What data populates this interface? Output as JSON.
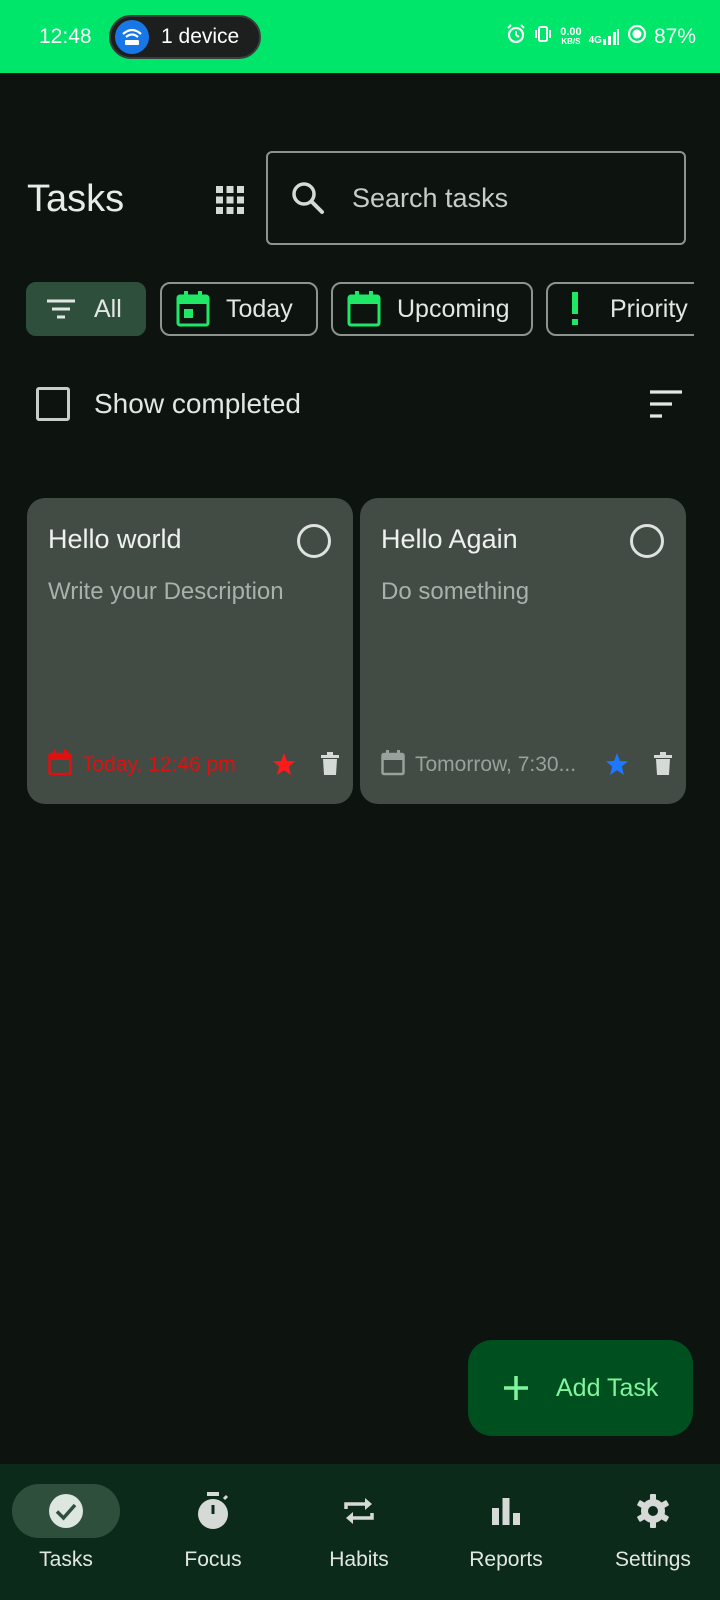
{
  "status_bar": {
    "time": "12:48",
    "hotspot_label": "1 device",
    "net_speed_value": "0.00",
    "net_speed_unit": "KB/S",
    "network": "4G",
    "battery": "87%"
  },
  "header": {
    "title": "Tasks",
    "search_placeholder": "Search tasks"
  },
  "filters": [
    {
      "label": "All",
      "icon": "filter-list-icon",
      "active": true
    },
    {
      "label": "Today",
      "icon": "calendar-today-icon",
      "active": false
    },
    {
      "label": "Upcoming",
      "icon": "calendar-icon",
      "active": false
    },
    {
      "label": "Priority",
      "icon": "priority-exclamation-icon",
      "active": false
    }
  ],
  "show_completed": {
    "label": "Show completed",
    "checked": false
  },
  "tasks": [
    {
      "title": "Hello world",
      "description": "Write your Description",
      "due": "Today, 12:46 pm",
      "due_color": "#e01010",
      "star_color": "#ff1a1a"
    },
    {
      "title": "Hello Again",
      "description": "Do something",
      "due": "Tomorrow, 7:30...",
      "due_color": "#9aa09b",
      "star_color": "#1e78ff"
    }
  ],
  "fab": {
    "label": "Add Task"
  },
  "nav": [
    {
      "label": "Tasks",
      "icon": "check-circle-icon",
      "active": true
    },
    {
      "label": "Focus",
      "icon": "timer-icon",
      "active": false
    },
    {
      "label": "Habits",
      "icon": "repeat-icon",
      "active": false
    },
    {
      "label": "Reports",
      "icon": "bar-chart-icon",
      "active": false
    },
    {
      "label": "Settings",
      "icon": "gear-icon",
      "active": false
    }
  ],
  "colors": {
    "status_bar": "#00e66a",
    "background": "#0d140f",
    "card": "#424b44",
    "accent_green": "#1ee866",
    "nav_bg": "#0c2a19",
    "fab_bg": "#00501f"
  }
}
